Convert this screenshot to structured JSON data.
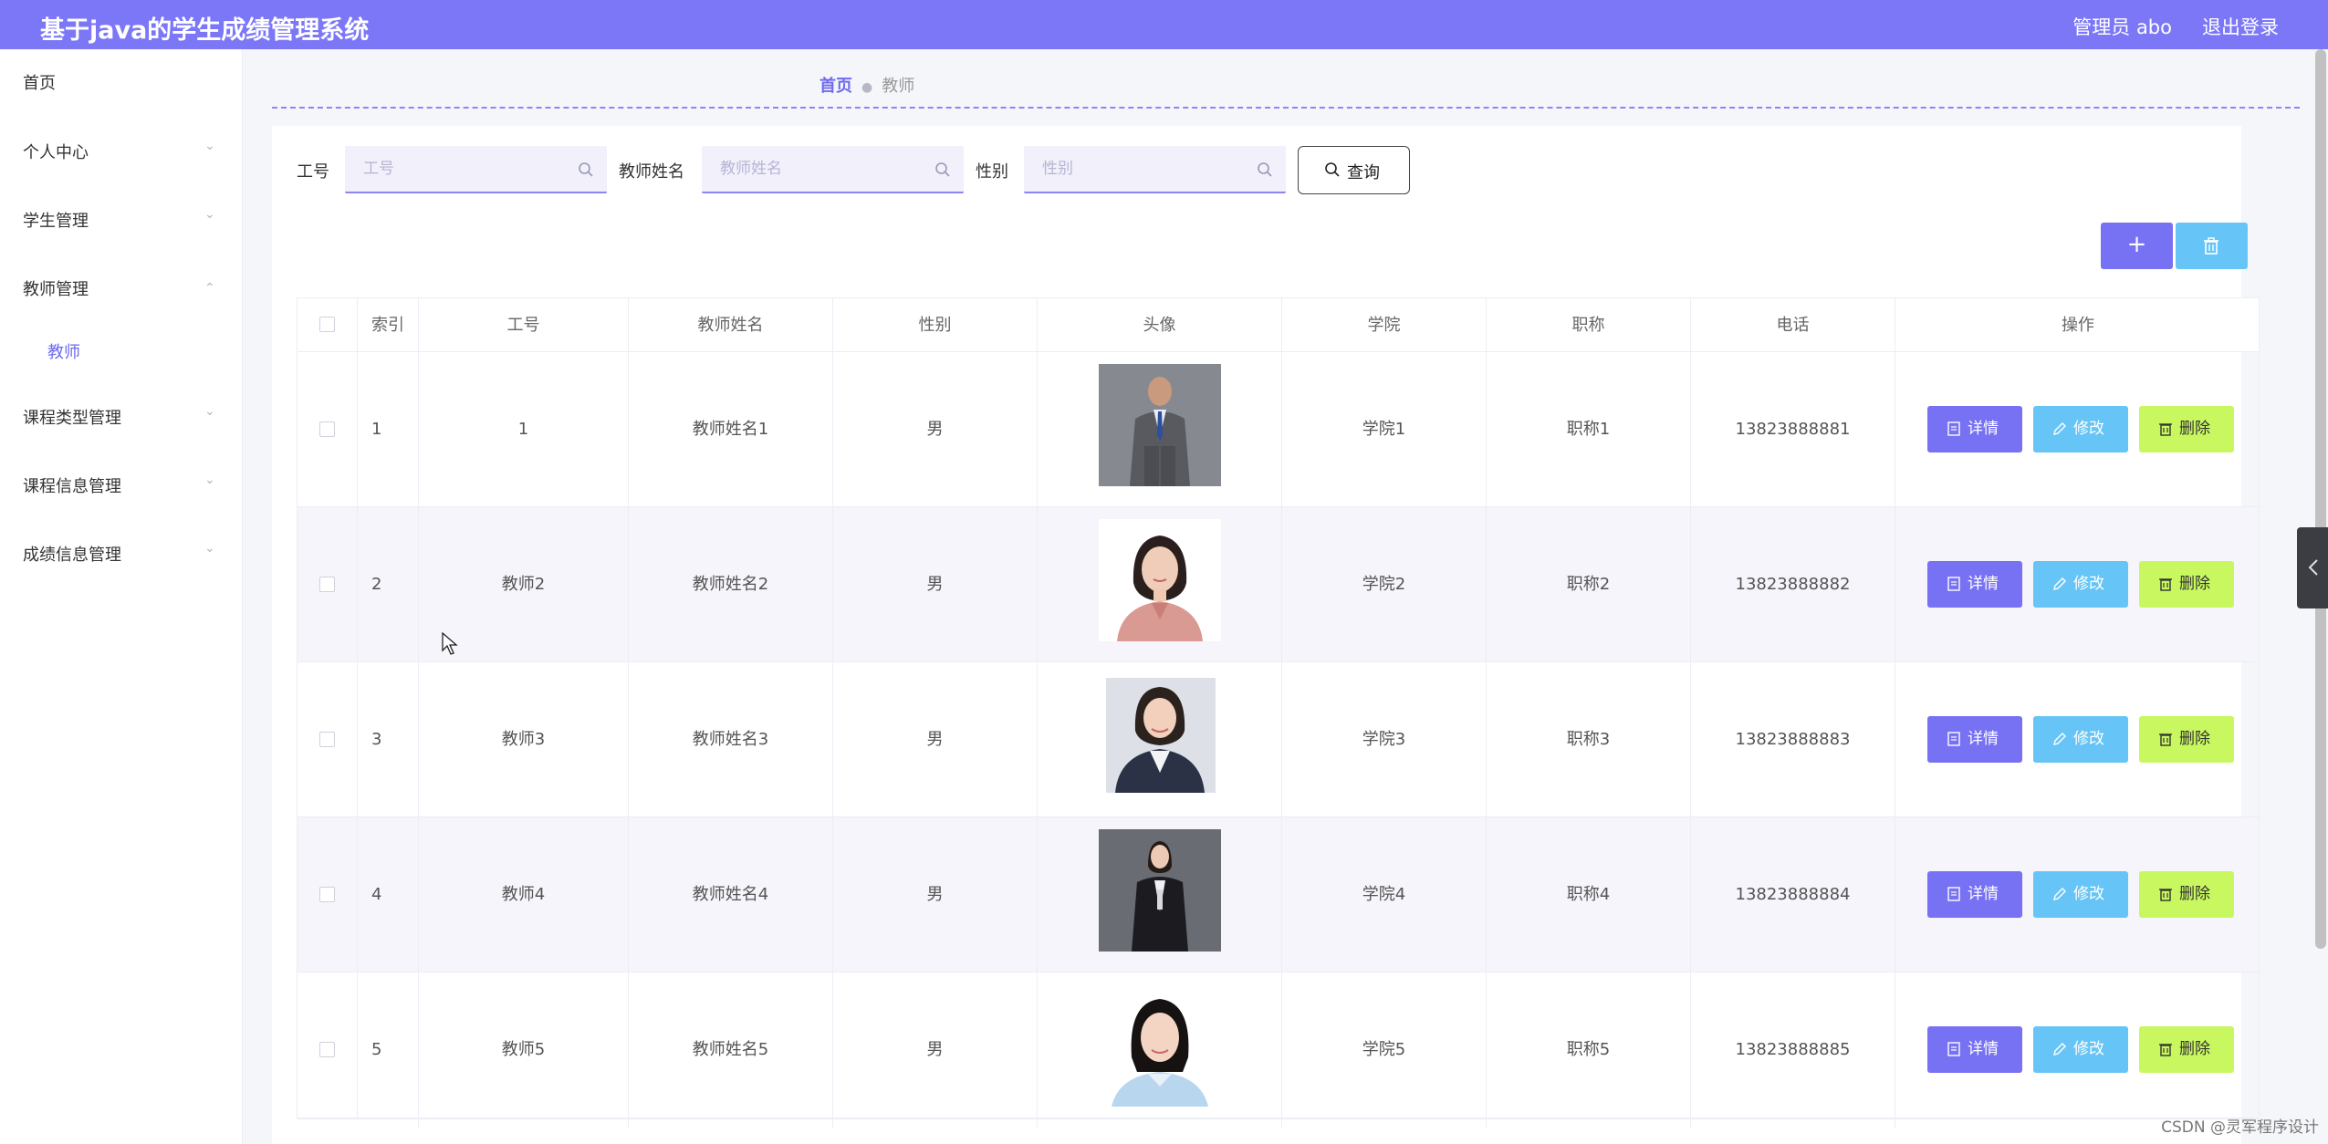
{
  "header": {
    "title": "基于java的学生成绩管理系统",
    "admin": "管理员 abo",
    "logout": "退出登录"
  },
  "sidebar": {
    "items": [
      {
        "label": "首页"
      },
      {
        "label": "个人中心"
      },
      {
        "label": "学生管理"
      },
      {
        "label": "教师管理"
      },
      {
        "label": "教师"
      },
      {
        "label": "课程类型管理"
      },
      {
        "label": "课程信息管理"
      },
      {
        "label": "成绩信息管理"
      }
    ]
  },
  "breadcrumb": {
    "home": "首页",
    "current": "教师"
  },
  "search": {
    "id_label": "工号",
    "id_placeholder": "工号",
    "name_label": "教师姓名",
    "name_placeholder": "教师姓名",
    "gender_label": "性别",
    "gender_placeholder": "性别",
    "query_label": "查询"
  },
  "toolbar": {
    "add_label": "+"
  },
  "table": {
    "headers": [
      "索引",
      "工号",
      "教师姓名",
      "性别",
      "头像",
      "学院",
      "职称",
      "电话",
      "操作"
    ],
    "rows": [
      {
        "index": "1",
        "id": "1",
        "name": "教师姓名1",
        "gender": "男",
        "college": "学院1",
        "title": "职称1",
        "phone": "13823888881"
      },
      {
        "index": "2",
        "id": "教师2",
        "name": "教师姓名2",
        "gender": "男",
        "college": "学院2",
        "title": "职称2",
        "phone": "13823888882"
      },
      {
        "index": "3",
        "id": "教师3",
        "name": "教师姓名3",
        "gender": "男",
        "college": "学院3",
        "title": "职称3",
        "phone": "13823888883"
      },
      {
        "index": "4",
        "id": "教师4",
        "name": "教师姓名4",
        "gender": "男",
        "college": "学院4",
        "title": "职称4",
        "phone": "13823888884"
      },
      {
        "index": "5",
        "id": "教师5",
        "name": "教师姓名5",
        "gender": "男",
        "college": "学院5",
        "title": "职称5",
        "phone": "13823888885"
      }
    ],
    "actions": {
      "detail": "详情",
      "edit": "修改",
      "delete": "删除"
    }
  },
  "watermark": "CSDN @灵军程序设计",
  "colors": {
    "primary": "#7b77f7",
    "info": "#66c5f6",
    "warn": "#c8f75f"
  }
}
